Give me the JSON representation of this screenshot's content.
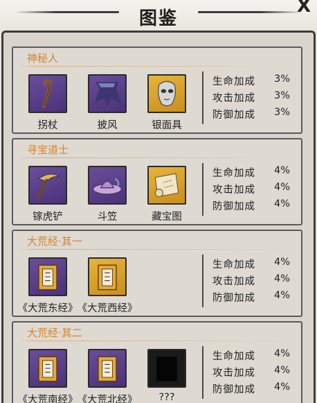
{
  "header": {
    "title": "图鉴",
    "close_label": "X"
  },
  "sets": [
    {
      "name": "神秘人",
      "items": [
        {
          "name": "拐杖",
          "icon": "cane-icon",
          "rarity": "purple"
        },
        {
          "name": "披风",
          "icon": "cloak-icon",
          "rarity": "purple"
        },
        {
          "name": "银面具",
          "icon": "silver-mask-icon",
          "rarity": "gold"
        }
      ],
      "stats": [
        {
          "label": "生命加成",
          "value": "3%"
        },
        {
          "label": "攻击加成",
          "value": "3%"
        },
        {
          "label": "防御加成",
          "value": "3%"
        }
      ]
    },
    {
      "name": "寻宝道士",
      "items": [
        {
          "name": "镓虎铲",
          "icon": "pickaxe-icon",
          "rarity": "purple"
        },
        {
          "name": "斗笠",
          "icon": "bamboo-hat-icon",
          "rarity": "purple"
        },
        {
          "name": "藏宝图",
          "icon": "treasure-map-icon",
          "rarity": "gold"
        }
      ],
      "stats": [
        {
          "label": "生命加成",
          "value": "4%"
        },
        {
          "label": "攻击加成",
          "value": "4%"
        },
        {
          "label": "防御加成",
          "value": "4%"
        }
      ]
    },
    {
      "name": "大荒经·其一",
      "items": [
        {
          "name": "《大荒东经》",
          "icon": "scripture-book-icon",
          "rarity": "purple"
        },
        {
          "name": "《大荒西经》",
          "icon": "scripture-book-icon",
          "rarity": "gold"
        }
      ],
      "stats": [
        {
          "label": "生命加成",
          "value": "4%"
        },
        {
          "label": "攻击加成",
          "value": "4%"
        },
        {
          "label": "防御加成",
          "value": "4%"
        }
      ]
    },
    {
      "name": "大荒经·其二",
      "items": [
        {
          "name": "《大荒南经》",
          "icon": "scripture-book-icon",
          "rarity": "purple"
        },
        {
          "name": "《大荒北经》",
          "icon": "scripture-book-icon",
          "rarity": "purple"
        },
        {
          "name": "???",
          "icon": "unknown-item-icon",
          "rarity": "locked"
        }
      ],
      "stats": [
        {
          "label": "生命加成",
          "value": "4%"
        },
        {
          "label": "攻击加成",
          "value": "4%"
        },
        {
          "label": "防御加成",
          "value": "4%"
        }
      ]
    }
  ],
  "colors": {
    "set_title": "#d9822b",
    "rare_purple": "#5b3f8a",
    "rare_gold": "#dba22e",
    "panel_border": "#3d3d3d"
  }
}
